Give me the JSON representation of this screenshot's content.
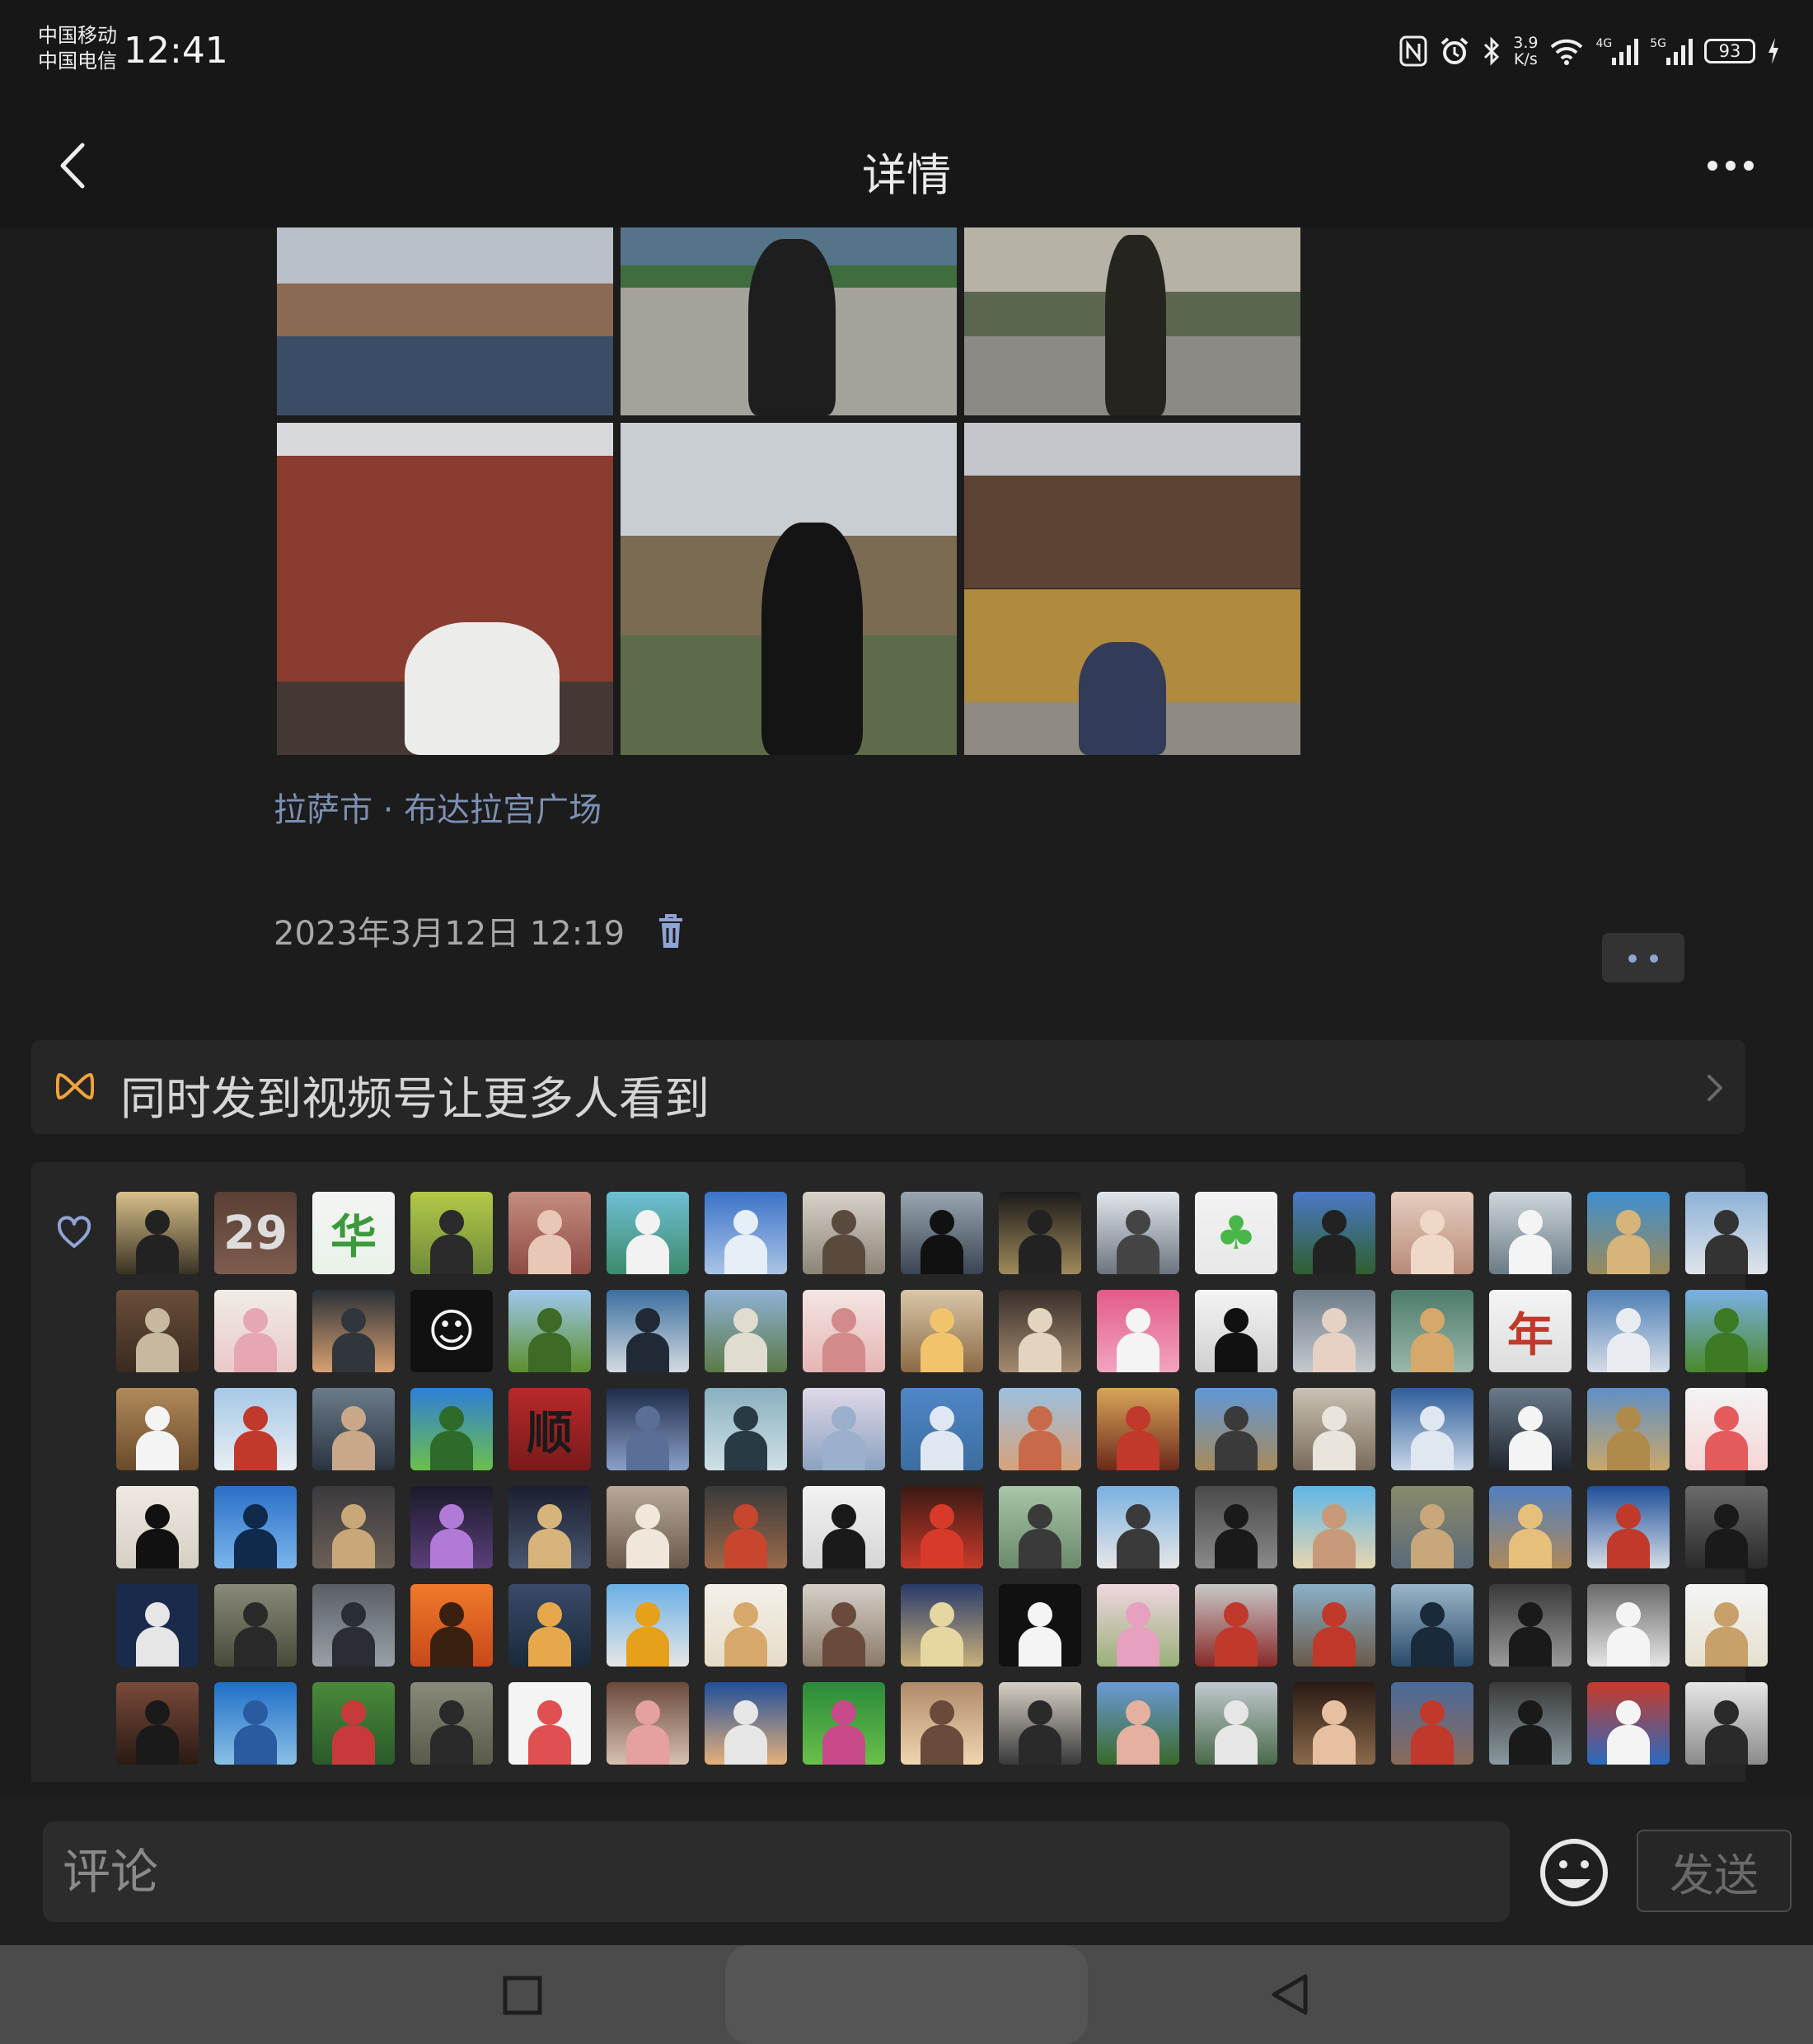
{
  "status_bar": {
    "carrier_1": "中国移动",
    "carrier_2": "中国电信",
    "time": "12:41",
    "net_speed_value": "3.9",
    "net_speed_unit": "K/s",
    "signal_1_tag": "4G",
    "signal_2_tag": "5G",
    "battery": "93",
    "icons": [
      "nfc-icon",
      "alarm-icon",
      "bluetooth-icon",
      "wifi-icon",
      "signal-icon",
      "signal-icon",
      "battery-icon",
      "charging-icon"
    ]
  },
  "header": {
    "title": "详情",
    "back_icon": "chevron-left-icon",
    "more_icon": "more-dots-icon"
  },
  "post": {
    "photos": [
      {
        "name": "photo-lake-palace",
        "bands": [
          [
            "0%",
            "48%",
            "#b8bfc8"
          ],
          [
            "30%",
            "28%",
            "#8a6a52"
          ],
          [
            "58%",
            "42%",
            "#3b4d66"
          ]
        ],
        "figure": null
      },
      {
        "name": "photo-man-with-camera-plaza",
        "bands": [
          [
            "0%",
            "30%",
            "#55748a"
          ],
          [
            "20%",
            "12%",
            "#3f6d3f"
          ],
          [
            "32%",
            "68%",
            "#a5a29a"
          ]
        ],
        "figure": [
          "38%",
          "6%",
          "26%",
          "94%",
          "#1e1e1e"
        ]
      },
      {
        "name": "photo-man-in-street",
        "bands": [
          [
            "0%",
            "34%",
            "#b7b2a6"
          ],
          [
            "34%",
            "24%",
            "#5b6651"
          ],
          [
            "58%",
            "42%",
            "#8d8a86"
          ]
        ],
        "figure": [
          "42%",
          "4%",
          "18%",
          "96%",
          "#26241f"
        ]
      },
      {
        "name": "photo-man-by-red-wall",
        "bands": [
          [
            "0%",
            "28%",
            "#d7d9dc"
          ],
          [
            "10%",
            "90%",
            "#8a3c30"
          ],
          [
            "78%",
            "22%",
            "#453834"
          ]
        ],
        "figure": [
          "38%",
          "60%",
          "46%",
          "40%",
          "#ececea"
        ]
      },
      {
        "name": "photo-silhouette-window",
        "bands": [
          [
            "0%",
            "34%",
            "#c9ced2"
          ],
          [
            "34%",
            "30%",
            "#7b6b52"
          ],
          [
            "64%",
            "36%",
            "#5d6b4a"
          ]
        ],
        "figure": [
          "42%",
          "30%",
          "30%",
          "70%",
          "#141414"
        ]
      },
      {
        "name": "photo-temple-courtyard",
        "bands": [
          [
            "0%",
            "16%",
            "#c3c7cc"
          ],
          [
            "16%",
            "34%",
            "#5c4333"
          ],
          [
            "50%",
            "34%",
            "#b08a3e"
          ],
          [
            "84%",
            "16%",
            "#8f8a82"
          ]
        ],
        "figure": [
          "34%",
          "66%",
          "26%",
          "34%",
          "#323b57"
        ]
      }
    ],
    "location": "拉萨市 · 布达拉宫广场",
    "date": "2023年3月12日 12:19",
    "delete_icon": "trash-icon",
    "action_icon": "more-dots-icon"
  },
  "channels_banner": {
    "icon": "channels-icon",
    "text": "同时发到视频号让更多人看到",
    "chevron_icon": "chevron-right-icon"
  },
  "likes": {
    "icon": "heart-outline-icon",
    "avatars": [
      {
        "bg": "linear-gradient(#d8c08a,#3a3324)",
        "fg": "#222"
      },
      {
        "bg": "linear-gradient(#5a3f34,#7d5c4f)",
        "tx": "29",
        "tc": "#ddd"
      },
      {
        "bg": "linear-gradient(#f4f4f4,#e9f2e9)",
        "tx": "华",
        "tc": "#3c9a3c"
      },
      {
        "bg": "linear-gradient(#b3c948,#6f8a3a)",
        "fg": "#2b2b2b"
      },
      {
        "bg": "linear-gradient(#c58c7e,#8e4b45)",
        "fg": "#e9c7b7"
      },
      {
        "bg": "linear-gradient(#6fbfd6,#3c8b6b)",
        "fg": "#f2f2f2"
      },
      {
        "bg": "linear-gradient(#3c73c8,#aac4e6)",
        "fg": "#e6eef8"
      },
      {
        "bg": "linear-gradient(#d8d2c9,#8d8478)",
        "fg": "#5a4a3e"
      },
      {
        "bg": "linear-gradient(#9aa6b2,#3b4552)",
        "fg": "#111"
      },
      {
        "bg": "linear-gradient(#1a1a1a,#a08a5a)",
        "fg": "#222"
      },
      {
        "bg": "linear-gradient(#e3e7ec,#6b7480)",
        "fg": "#444"
      },
      {
        "bg": "linear-gradient(#f2f2f2,#e8e8e8)",
        "tx": "♣",
        "tc": "#49b649"
      },
      {
        "bg": "linear-gradient(#4b79c7,#2e5f2e)",
        "fg": "#222"
      },
      {
        "bg": "linear-gradient(#e6cfc0,#b88a78)",
        "fg": "#f0d8c8"
      },
      {
        "bg": "linear-gradient(#cfd6dc,#6b7b86)",
        "fg": "#f4f4f4"
      },
      {
        "bg": "linear-gradient(#3f8fd0,#9a8a5a)",
        "fg": "#d6b47a"
      },
      {
        "bg": "linear-gradient(#8db2d8,#e0e4ea)",
        "fg": "#333"
      },
      {
        "bg": "linear-gradient(#6a4e3a,#3a2a20)",
        "fg": "#c9b8a0"
      },
      {
        "bg": "linear-gradient(#f1ece6,#e9c9c9)",
        "fg": "#e6a7b3"
      },
      {
        "bg": "linear-gradient(#2b3138,#d8a070)",
        "fg": "#31363c"
      },
      {
        "bg": "linear-gradient(#111,#111)",
        "tx": "☺",
        "tc": "#f4f4f4"
      },
      {
        "bg": "linear-gradient(#9ec8ef,#5b8f2a)",
        "fg": "#3d6a24"
      },
      {
        "bg": "linear-gradient(#3b6fa0,#d4dae0)",
        "fg": "#1f2a36"
      },
      {
        "bg": "linear-gradient(#8fb2d6,#5b7a48)",
        "fg": "#e0dccf"
      },
      {
        "bg": "linear-gradient(#f3e6e2,#e6b5b5)",
        "fg": "#d38a8a"
      },
      {
        "bg": "linear-gradient(#d9c7a8,#8b6a46)",
        "fg": "#f1c36a"
      },
      {
        "bg": "linear-gradient(#3a2f2a,#a38a70)",
        "fg": "#e3d4c0"
      },
      {
        "bg": "linear-gradient(#e35b8a,#f1a4c0)",
        "fg": "#f4f4f4"
      },
      {
        "bg": "linear-gradient(#f4f4f4,#cfcfcf)",
        "fg": "#111"
      },
      {
        "bg": "linear-gradient(#6d7c8a,#c4c9ce)",
        "fg": "#e6d1c3"
      },
      {
        "bg": "linear-gradient(#4d7c6a,#9bb7aa)",
        "fg": "#d6a96a"
      },
      {
        "bg": "linear-gradient(#f4f4f4,#ddd)",
        "tx": "年",
        "tc": "#c0392b"
      },
      {
        "bg": "linear-gradient(#4f7fb6,#d6dde6)",
        "fg": "#e8ecf0"
      },
      {
        "bg": "linear-gradient(#7ab0e6,#4b8a2a)",
        "fg": "#3c7a24"
      },
      {
        "bg": "linear-gradient(#b08a5a,#6a4a2a)",
        "fg": "#f4f4f4"
      },
      {
        "bg": "linear-gradient(#a6c8e6,#e8eef4)",
        "fg": "#c0392b"
      },
      {
        "bg": "linear-gradient(#6b7b8a,#2a3440)",
        "fg": "#c9a88a"
      },
      {
        "bg": "linear-gradient(#2e7fd8,#6bbf4a)",
        "fg": "#2e6a2a"
      },
      {
        "bg": "linear-gradient(#b8292a,#7a1a1a)",
        "tx": "顺",
        "tc": "#1a1a1a"
      },
      {
        "bg": "linear-gradient(#1f2c4a,#8aa0c8)",
        "fg": "#5a6f98"
      },
      {
        "bg": "linear-gradient(#8ab0c0,#cfe0e6)",
        "fg": "#2a3a44"
      },
      {
        "bg": "linear-gradient(#e0d8e8,#8aa2c0)",
        "fg": "#9ab0cc"
      },
      {
        "bg": "linear-gradient(#4f86c6,#3c6ea0)",
        "fg": "#dfe8f2"
      },
      {
        "bg": "linear-gradient(#9cc0e0,#d6a27a)",
        "fg": "#c86a4a"
      },
      {
        "bg": "linear-gradient(#d9a55a,#6b2a1a)",
        "fg": "#c0392b"
      },
      {
        "bg": "linear-gradient(#5f98d8,#a88a5a)",
        "fg": "#3a3a3a"
      },
      {
        "bg": "linear-gradient(#c9c2b4,#7a6b5a)",
        "fg": "#e9e4dc"
      },
      {
        "bg": "linear-gradient(#2f5f9a,#c8d6e8)",
        "fg": "#dfe7f1"
      },
      {
        "bg": "linear-gradient(#6a7a8a,#1f2630)",
        "fg": "#f4f4f4"
      },
      {
        "bg": "linear-gradient(#5f8fc8,#c9a86a)",
        "fg": "#b08a4a"
      },
      {
        "bg": "linear-gradient(#f4f4f4,#f6d6d6)",
        "fg": "#e35b5b"
      },
      {
        "bg": "linear-gradient(#efe9e0,#d6cfc4)",
        "fg": "#111"
      },
      {
        "bg": "linear-gradient(#2b6fc8,#7ab6ec)",
        "fg": "#0f2a4a"
      },
      {
        "bg": "linear-gradient(#3b3a3f,#6b6056)",
        "fg": "#c8a878"
      },
      {
        "bg": "linear-gradient(#1a1a2a,#5b3f7a)",
        "fg": "#b07ad6"
      },
      {
        "bg": "linear-gradient(#1a2030,#4a5670)",
        "fg": "#d6b47a"
      },
      {
        "bg": "linear-gradient(#b8a89a,#6a5a4a)",
        "fg": "#f1e6da"
      },
      {
        "bg": "linear-gradient(#3a3a3a,#9a6a4a)",
        "fg": "#c8462e"
      },
      {
        "bg": "linear-gradient(#f2f2f2,#d6d6d6)",
        "fg": "#1a1a1a"
      },
      {
        "bg": "linear-gradient(#3a1a14,#c83a2a)",
        "fg": "#d83a2a"
      },
      {
        "bg": "linear-gradient(#a8c6a8,#6b8a6a)",
        "fg": "#3a3a3a"
      },
      {
        "bg": "linear-gradient(#7ab0e0,#e6e6e6)",
        "fg": "#3a3a3a"
      },
      {
        "bg": "linear-gradient(#4a4a4a,#8a8a8a)",
        "fg": "#1a1a1a"
      },
      {
        "bg": "linear-gradient(#5fb6e6,#e6d6b0)",
        "fg": "#c89a7a"
      },
      {
        "bg": "linear-gradient(#8a8a6a,#5a6a7a)",
        "fg": "#c8a87a"
      },
      {
        "bg": "linear-gradient(#4f7fc0,#b08a5a)",
        "fg": "#e6c07a"
      },
      {
        "bg": "linear-gradient(#1f4f9a,#d6dde6)",
        "fg": "#c0392b"
      },
      {
        "bg": "linear-gradient(#6a6a6a,#2a2a2a)",
        "fg": "#1a1a1a"
      },
      {
        "bg": "linear-gradient(#1a2a4a,#1a2a4a)",
        "fg": "#e6e6e6"
      },
      {
        "bg": "linear-gradient(#8a8a7a,#4a4a3a)",
        "fg": "#2a2a2a"
      },
      {
        "bg": "linear-gradient(#5a5f66,#9aa0a8)",
        "fg": "#2a2e34"
      },
      {
        "bg": "linear-gradient(#f07a2a,#c8481a)",
        "fg": "#3a2010"
      },
      {
        "bg": "linear-gradient(#3a4a6a,#1a2a3a)",
        "fg": "#e6a84a"
      },
      {
        "bg": "linear-gradient(#6ab0e6,#e6e6e6)",
        "fg": "#e6a01a"
      },
      {
        "bg": "linear-gradient(#f4f0e8,#e6dcc8)",
        "fg": "#d6a86a"
      },
      {
        "bg": "linear-gradient(#d6d0c8,#8a7a6a)",
        "fg": "#6a4a3a"
      },
      {
        "bg": "linear-gradient(#2a3a6a,#c8b07a)",
        "fg": "#e6d6a0"
      },
      {
        "bg": "linear-gradient(#111,#111)",
        "fg": "#f4f4f4"
      },
      {
        "bg": "linear-gradient(#f0d6e0,#9ab07a)",
        "fg": "#e6a0c0"
      },
      {
        "bg": "linear-gradient(#c8c8c8,#8a2a2a)",
        "fg": "#c0392b"
      },
      {
        "bg": "linear-gradient(#8ab0c8,#6a5a4a)",
        "fg": "#c0392b"
      },
      {
        "bg": "linear-gradient(#9ab6c8,#2a4a6a)",
        "fg": "#1a2a3a"
      },
      {
        "bg": "linear-gradient(#3a3a3a,#9a9a9a)",
        "fg": "#1a1a1a"
      },
      {
        "bg": "linear-gradient(#6a6a6a,#e6e6e6)",
        "fg": "#f4f4f4"
      },
      {
        "bg": "linear-gradient(#f4f4f4,#e6e0d0)",
        "fg": "#c8a06a"
      },
      {
        "bg": "linear-gradient(#7a4a3a,#2a1a14)",
        "fg": "#1a1a1a"
      },
      {
        "bg": "linear-gradient(#1f6fc8,#8ac0e6)",
        "fg": "#2a5aa0"
      },
      {
        "bg": "linear-gradient(#4a8a3a,#2a5a2a)",
        "fg": "#c83a3a"
      },
      {
        "bg": "linear-gradient(#8a8a7a,#5a5a4a)",
        "fg": "#2a2a2a"
      },
      {
        "bg": "linear-gradient(#f4f4f4,#f4f4f4)",
        "fg": "#e05050"
      },
      {
        "bg": "linear-gradient(#6a4a3a,#d6c0b0)",
        "fg": "#e6a0a0"
      },
      {
        "bg": "linear-gradient(#1f4f9a,#e6b07a)",
        "fg": "#e6e6e6"
      },
      {
        "bg": "linear-gradient(#2a8a3a,#6ac04a)",
        "fg": "#c84a8a"
      },
      {
        "bg": "linear-gradient(#b08a6a,#f0d6b0)",
        "fg": "#6a4a3a"
      },
      {
        "bg": "linear-gradient(#d6cfc4,#3a3a3a)",
        "fg": "#2a2a2a"
      },
      {
        "bg": "linear-gradient(#6a9ad6,#3a6a2a)",
        "fg": "#e6b0a0"
      },
      {
        "bg": "linear-gradient(#c0c8d0,#4a6a4a)",
        "fg": "#e6e6e6"
      },
      {
        "bg": "linear-gradient(#2a1a14,#8a6a4a)",
        "fg": "#e6c0a0"
      },
      {
        "bg": "linear-gradient(#4a6a9a,#8a6a5a)",
        "fg": "#c0392b"
      },
      {
        "bg": "linear-gradient(#3a3a3a,#8a9aa0)",
        "fg": "#1a1a1a"
      },
      {
        "bg": "linear-gradient(#c83a2a,#2a6ac0)",
        "fg": "#f4f4f4"
      },
      {
        "bg": "linear-gradient(#e6e6e6,#8a8a8a)",
        "fg": "#2a2a2a"
      }
    ]
  },
  "comment_bar": {
    "placeholder": "评论",
    "emoji_icon": "emoji-icon",
    "send_label": "发送"
  },
  "nav_bar": {
    "home_icon": "square-home-icon",
    "back_icon": "triangle-back-icon"
  },
  "colors": {
    "background": "#1c1c1c",
    "bar": "#171717",
    "card": "#262626",
    "link": "#7d90b4",
    "channels_accent": "#f2a33a",
    "like_icon": "#8fa4d6"
  }
}
